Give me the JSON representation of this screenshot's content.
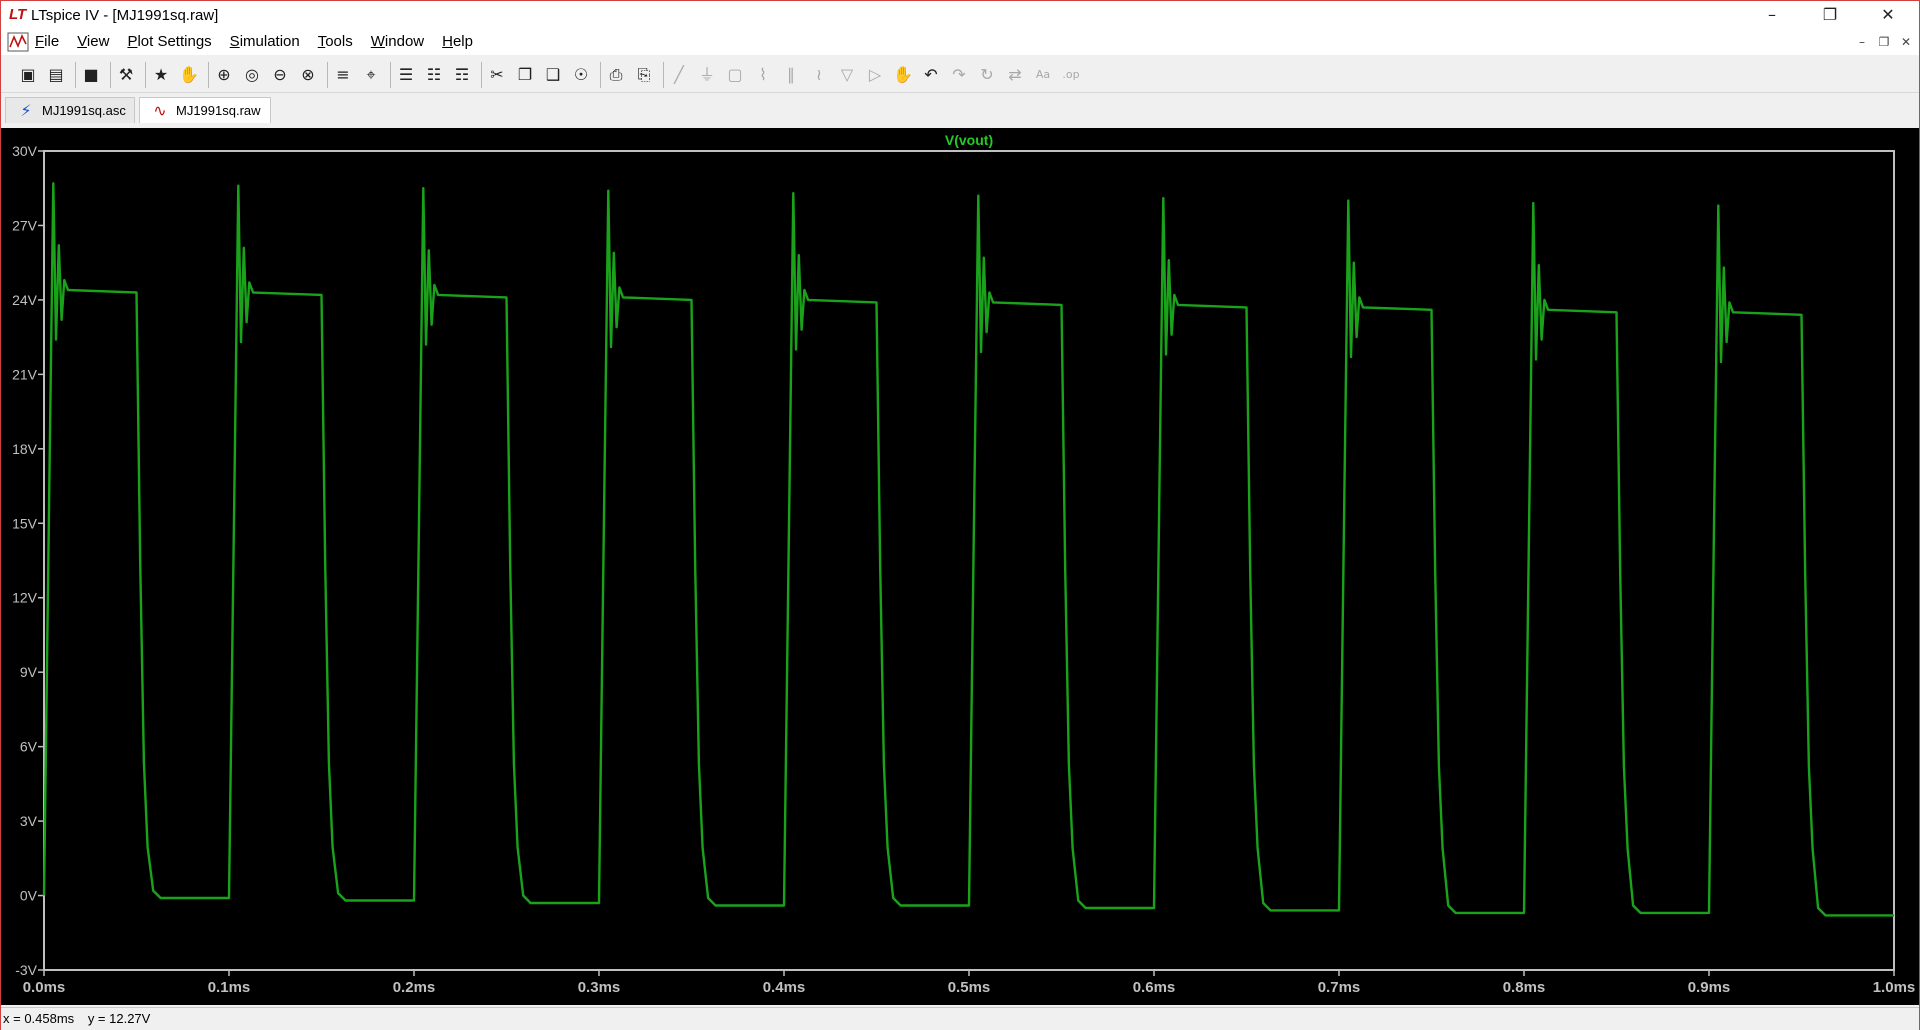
{
  "window": {
    "title": "LTspice IV - [MJ1991sq.raw]"
  },
  "menu": [
    {
      "label": "File",
      "key": "F"
    },
    {
      "label": "View",
      "key": "V"
    },
    {
      "label": "Plot Settings",
      "key": "P"
    },
    {
      "label": "Simulation",
      "key": "S"
    },
    {
      "label": "Tools",
      "key": "T"
    },
    {
      "label": "Window",
      "key": "W"
    },
    {
      "label": "Help",
      "key": "H"
    }
  ],
  "toolbar": [
    {
      "name": "new-schematic-icon",
      "glyph": "▣",
      "enabled": true
    },
    {
      "name": "open-icon",
      "glyph": "▤",
      "enabled": true
    },
    {
      "sep": true
    },
    {
      "name": "save-icon",
      "glyph": "■",
      "enabled": true
    },
    {
      "sep": true
    },
    {
      "name": "control-panel-icon",
      "glyph": "⚒",
      "enabled": true
    },
    {
      "sep": true
    },
    {
      "name": "run-icon",
      "glyph": "★",
      "enabled": true
    },
    {
      "name": "pan-hand-icon",
      "glyph": "✋",
      "enabled": false
    },
    {
      "sep": true
    },
    {
      "name": "zoom-in-icon",
      "glyph": "⊕",
      "enabled": true
    },
    {
      "name": "zoom-area-icon",
      "glyph": "◎",
      "enabled": true
    },
    {
      "name": "zoom-out-icon",
      "glyph": "⊖",
      "enabled": true
    },
    {
      "name": "zoom-fit-icon",
      "glyph": "⊗",
      "enabled": true
    },
    {
      "sep": true
    },
    {
      "name": "autorange-icon",
      "glyph": "≡",
      "enabled": true
    },
    {
      "name": "plot-area-icon",
      "glyph": "⌖",
      "enabled": true
    },
    {
      "sep": true
    },
    {
      "name": "tile-horizontal-icon",
      "glyph": "☰",
      "enabled": true
    },
    {
      "name": "cascade-icon",
      "glyph": "☷",
      "enabled": true
    },
    {
      "name": "tile-vertical-icon",
      "glyph": "☶",
      "enabled": true
    },
    {
      "sep": true
    },
    {
      "name": "cut-icon",
      "glyph": "✂",
      "enabled": true
    },
    {
      "name": "copy-icon",
      "glyph": "❐",
      "enabled": true
    },
    {
      "name": "paste-icon",
      "glyph": "❑",
      "enabled": true
    },
    {
      "name": "find-icon",
      "glyph": "☉",
      "enabled": true
    },
    {
      "sep": true
    },
    {
      "name": "print-preview-icon",
      "glyph": "⎙",
      "enabled": true
    },
    {
      "name": "print-icon",
      "glyph": "⎘",
      "enabled": true
    },
    {
      "sep": true
    },
    {
      "name": "wire-icon",
      "glyph": "╱",
      "enabled": false
    },
    {
      "name": "ground-icon",
      "glyph": "⏚",
      "enabled": false
    },
    {
      "name": "label-net-icon",
      "glyph": "▢",
      "enabled": false
    },
    {
      "name": "resistor-icon",
      "glyph": "⌇",
      "enabled": false
    },
    {
      "name": "capacitor-icon",
      "glyph": "∥",
      "enabled": false
    },
    {
      "name": "inductor-icon",
      "glyph": "≀",
      "enabled": false
    },
    {
      "name": "diode-icon",
      "glyph": "▽",
      "enabled": false
    },
    {
      "name": "component-icon",
      "glyph": "▷",
      "enabled": false
    },
    {
      "name": "move-icon",
      "glyph": "✋",
      "enabled": false
    },
    {
      "name": "undo-icon",
      "glyph": "↶",
      "enabled": true
    },
    {
      "name": "redo-icon",
      "glyph": "↷",
      "enabled": false
    },
    {
      "name": "rotate-icon",
      "glyph": "↻",
      "enabled": false
    },
    {
      "name": "mirror-icon",
      "glyph": "⇄",
      "enabled": false
    },
    {
      "name": "text-icon",
      "glyph": "Aa",
      "enabled": false
    },
    {
      "name": "spice-directive-icon",
      "glyph": ".op",
      "enabled": false
    }
  ],
  "tabs": [
    {
      "label": "MJ1991sq.asc",
      "icon": "schematic-icon",
      "glyph": "⚡",
      "active": false
    },
    {
      "label": "MJ1991sq.raw",
      "icon": "waveform-icon",
      "glyph": "∿",
      "active": true
    }
  ],
  "status": {
    "x_readout": "x = 0.458ms",
    "y_readout": "y = 12.27V"
  },
  "colors": {
    "trace": "#1aa31a",
    "trace_title": "#22cc22",
    "axis": "#c0c0c0",
    "grid_text": "#c0c0c0",
    "background": "#000000"
  },
  "chart_data": {
    "type": "line",
    "title": "V(vout)",
    "xlabel": "",
    "ylabel": "",
    "xlim": [
      0,
      1.0
    ],
    "ylim": [
      -3,
      30
    ],
    "x_unit": "ms",
    "y_unit": "V",
    "x_ticks": [
      "0.0ms",
      "0.1ms",
      "0.2ms",
      "0.3ms",
      "0.4ms",
      "0.5ms",
      "0.6ms",
      "0.7ms",
      "0.8ms",
      "0.9ms",
      "1.0ms"
    ],
    "y_ticks": [
      "30V",
      "27V",
      "24V",
      "21V",
      "18V",
      "15V",
      "12V",
      "9V",
      "6V",
      "3V",
      "0V",
      "-3V"
    ],
    "grid": false,
    "series": [
      {
        "name": "V(vout)",
        "period_ms": 0.1,
        "duty_high_ms": 0.05,
        "cycles": [
          {
            "rise_ms": 0.0,
            "fall_ms": 0.05,
            "peak_v": 28.7,
            "high_v": 24.4,
            "low_v": -0.1
          },
          {
            "rise_ms": 0.1,
            "fall_ms": 0.15,
            "peak_v": 28.6,
            "high_v": 24.3,
            "low_v": -0.2
          },
          {
            "rise_ms": 0.2,
            "fall_ms": 0.25,
            "peak_v": 28.5,
            "high_v": 24.2,
            "low_v": -0.3
          },
          {
            "rise_ms": 0.3,
            "fall_ms": 0.35,
            "peak_v": 28.4,
            "high_v": 24.1,
            "low_v": -0.4
          },
          {
            "rise_ms": 0.4,
            "fall_ms": 0.45,
            "peak_v": 28.3,
            "high_v": 24.0,
            "low_v": -0.4
          },
          {
            "rise_ms": 0.5,
            "fall_ms": 0.55,
            "peak_v": 28.2,
            "high_v": 23.9,
            "low_v": -0.5
          },
          {
            "rise_ms": 0.6,
            "fall_ms": 0.65,
            "peak_v": 28.1,
            "high_v": 23.8,
            "low_v": -0.6
          },
          {
            "rise_ms": 0.7,
            "fall_ms": 0.75,
            "peak_v": 28.0,
            "high_v": 23.7,
            "low_v": -0.7
          },
          {
            "rise_ms": 0.8,
            "fall_ms": 0.85,
            "peak_v": 27.9,
            "high_v": 23.6,
            "low_v": -0.7
          },
          {
            "rise_ms": 0.9,
            "fall_ms": 0.95,
            "peak_v": 27.8,
            "high_v": 23.5,
            "low_v": -0.8
          }
        ]
      }
    ]
  }
}
